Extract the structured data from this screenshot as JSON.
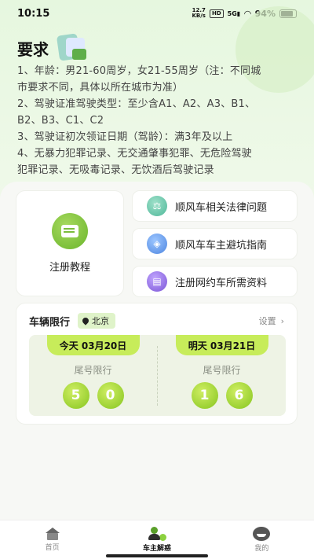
{
  "status_bar": {
    "time": "10:15",
    "speed_value": "12.7",
    "speed_unit": "KB/s",
    "hd": "HD",
    "net": "5G",
    "battery": "94%"
  },
  "requirements": {
    "title": "要求",
    "lines": [
      "1、年龄：男21-60周岁，女21-55周岁（注：不同城",
      "市要求不同，具体以所在城市为准）",
      "2、驾驶证准驾驶类型：至少含A1、A2、A3、B1、",
      "B2、B3、C1、C2",
      "3、驾驶证初次领证日期（驾龄）：满3年及以上",
      "4、无暴力犯罪记录、无交通肇事犯罪、无危险驾驶",
      "犯罪记录、无吸毒记录、无饮酒后驾驶记录"
    ]
  },
  "tutorial": {
    "label": "注册教程",
    "icon": "book-icon"
  },
  "links": [
    {
      "label": "顺风车相关法律问题",
      "icon": "scale-icon"
    },
    {
      "label": "顺风车车主避坑指南",
      "icon": "compass-icon"
    },
    {
      "label": "注册网约车所需资料",
      "icon": "document-icon"
    }
  ],
  "restriction": {
    "title": "车辆限行",
    "city": "北京",
    "settings": "设置",
    "days": [
      {
        "tag": "今天 03月20日",
        "label": "尾号限行",
        "digits": [
          "5",
          "0"
        ]
      },
      {
        "tag": "明天 03月21日",
        "label": "尾号限行",
        "digits": [
          "1",
          "6"
        ]
      }
    ]
  },
  "tabs": [
    {
      "label": "首页",
      "icon": "home-icon",
      "active": false
    },
    {
      "label": "车主解惑",
      "icon": "owner-qa-icon",
      "active": true
    },
    {
      "label": "我的",
      "icon": "profile-icon",
      "active": false
    }
  ],
  "colors": {
    "accent": "#c7ec5a",
    "digit_green": "#86c51f",
    "background": "#f5f6f3"
  }
}
